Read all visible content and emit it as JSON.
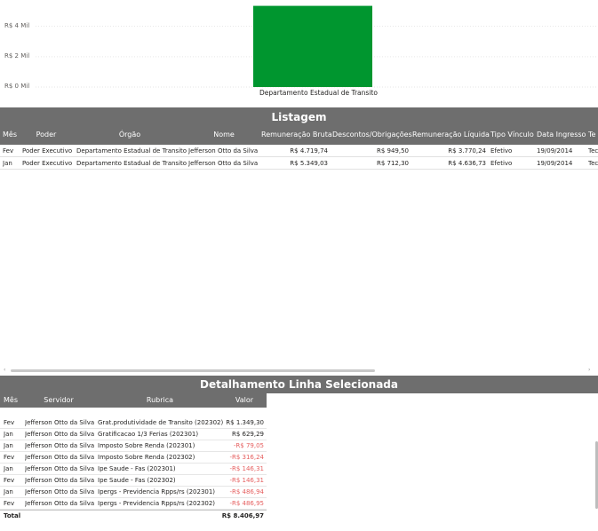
{
  "chart_data": {
    "type": "bar",
    "categories": [
      "Departamento Estadual de Transito"
    ],
    "values": [
      5.349
    ],
    "ylim": [
      0,
      5.5
    ],
    "ytick_values": [
      0,
      2,
      4
    ],
    "ytick_labels": [
      "R$ 0 Mil",
      "R$ 2 Mil",
      "R$ 4 Mil"
    ],
    "bar_color": "#00962f",
    "grid": true
  },
  "listagem": {
    "title": "Listagem",
    "columns": [
      "Mês",
      "Poder",
      "Órgão",
      "Nome",
      "Remuneração Bruta",
      "Descontos/Obrigações",
      "Remuneração Líquida",
      "Tipo Vínculo",
      "Data Ingresso",
      "Te"
    ],
    "rows": [
      [
        "Fev",
        "Poder Executivo",
        "Departamento Estadual de Transito",
        "Jefferson Otto da Silva",
        "R$ 4.719,74",
        "R$ 949,50",
        "R$ 3.770,24",
        "Efetivo",
        "19/09/2014",
        "Tec"
      ],
      [
        "Jan",
        "Poder Executivo",
        "Departamento Estadual de Transito",
        "Jefferson Otto da Silva",
        "R$ 5.349,03",
        "R$ 712,30",
        "R$ 4.636,73",
        "Efetivo",
        "19/09/2014",
        "Tec"
      ]
    ]
  },
  "detalhamento": {
    "title": "Detalhamento Linha Selecionada",
    "columns": [
      "Mês",
      "Servidor",
      "Rubrica",
      "Valor"
    ],
    "rows": [
      [
        "Fev",
        "Jefferson Otto da Silva",
        "Grat.produtividade de Transito (202302)",
        "R$ 1.349,30"
      ],
      [
        "Jan",
        "Jefferson Otto da Silva",
        "Gratificacao 1/3 Ferias (202301)",
        "R$ 629,29"
      ],
      [
        "Jan",
        "Jefferson Otto da Silva",
        "Imposto Sobre Renda (202301)",
        "-R$ 79,05"
      ],
      [
        "Fev",
        "Jefferson Otto da Silva",
        "Imposto Sobre Renda (202302)",
        "-R$ 316,24"
      ],
      [
        "Jan",
        "Jefferson Otto da Silva",
        "Ipe Saude - Fas (202301)",
        "-R$ 146,31"
      ],
      [
        "Fev",
        "Jefferson Otto da Silva",
        "Ipe Saude - Fas (202302)",
        "-R$ 146,31"
      ],
      [
        "Jan",
        "Jefferson Otto da Silva",
        "Ipergs - Previdencia Rpps/rs (202301)",
        "-R$ 486,94"
      ],
      [
        "Fev",
        "Jefferson Otto da Silva",
        "Ipergs - Previdencia Rpps/rs (202302)",
        "-R$ 486,95"
      ]
    ],
    "total_label": "Total",
    "total_value": "R$ 8.406,97"
  },
  "scroll_left_arrow": "‹",
  "scroll_right_arrow": "›"
}
